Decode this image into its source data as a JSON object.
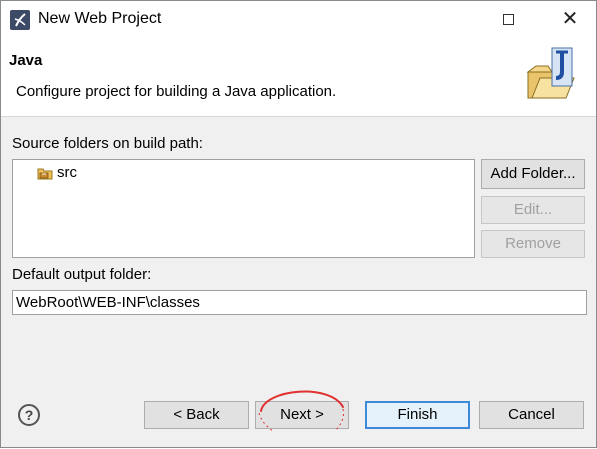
{
  "window": {
    "title": "New Web Project",
    "close_glyph": "✕"
  },
  "banner": {
    "title": "Java",
    "description": "Configure project for building a Java application.",
    "icon": "java-folder-icon"
  },
  "source_folders": {
    "label": "Source folders on build path:",
    "items": [
      {
        "label": "src",
        "icon": "package-folder-icon"
      }
    ],
    "buttons": {
      "add_folder": "Add Folder...",
      "edit": "Edit...",
      "remove": "Remove"
    }
  },
  "output": {
    "label": "Default output folder:",
    "value": "WebRoot\\WEB-INF\\classes"
  },
  "footer": {
    "help_glyph": "?",
    "back": "< Back",
    "next": "Next >",
    "finish": "Finish",
    "cancel": "Cancel"
  },
  "colors": {
    "default_button_border": "#3d8ad8",
    "annotation": "#e03030"
  }
}
